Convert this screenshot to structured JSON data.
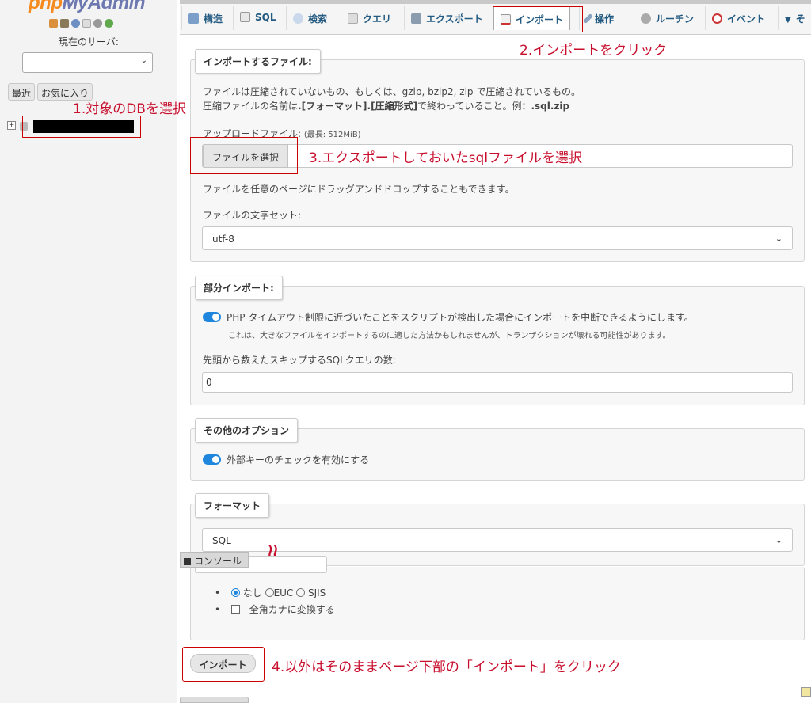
{
  "left": {
    "logo_a": "php",
    "logo_b": "MyAdmin",
    "server_label": "現在のサーバ:",
    "server_value": "",
    "recent_label": "最近",
    "favorites_label": "お気に入り",
    "tree_expander": "+"
  },
  "tabs": [
    {
      "label": "構造",
      "icon": "structure-icon"
    },
    {
      "label": "SQL",
      "icon": "sql-icon"
    },
    {
      "label": "検索",
      "icon": "search-icon"
    },
    {
      "label": "クエリ",
      "icon": "query-icon"
    },
    {
      "label": "エクスポート",
      "icon": "export-icon"
    },
    {
      "label": "インポート",
      "icon": "import-icon"
    },
    {
      "label": "操作",
      "icon": "wrench-icon"
    },
    {
      "label": "ルーチン",
      "icon": "routines-icon"
    },
    {
      "label": "イベント",
      "icon": "clock-icon"
    },
    {
      "label": "そ",
      "icon": "chevron-down-icon"
    }
  ],
  "import_file": {
    "legend": "インポートするファイル:",
    "desc1": "ファイルは圧縮されていないもの、もしくは、gzip, bzip2, zip で圧縮されているもの。",
    "desc2_prefix": "圧縮ファイルの名前は",
    "desc2_bold1": ".[フォーマット].[圧縮形式]",
    "desc2_mid": "で終わっていること。例：",
    "desc2_bold2": ".sql.zip",
    "upload_label": "アップロードファイル:",
    "upload_max": "(最長: 512MiB)",
    "choose_file": "ファイルを選択",
    "drag_note": "ファイルを任意のページにドラッグアンドドロップすることもできます。",
    "charset_label": "ファイルの文字セット:",
    "charset_value": "utf-8"
  },
  "partial": {
    "legend": "部分インポート:",
    "toggle_label": "PHP タイムアウト制限に近づいたことをスクリプトが検出した場合にインポートを中断できるようにします。",
    "toggle_note": "これは、大きなファイルをインポートするのに適した方法かもしれませんが、トランザクションが壊れる可能性があります。",
    "skip_label": "先頭から数えたスキップするSQLクエリの数:",
    "skip_value": "0"
  },
  "other": {
    "legend": "その他のオプション",
    "fk_label": "外部キーのチェックを有効にする"
  },
  "format": {
    "legend": "フォーマット",
    "value": "SQL",
    "opt_none": "なし",
    "opt_euc": "EUC",
    "opt_sjis": "SJIS",
    "kana_label": "全角カナに変換する"
  },
  "console_label": "コンソール",
  "import_button": "インポート",
  "annotations": {
    "a1": "1.対象のDBを選択",
    "a2": "2.インポートをクリック",
    "a3": "3.エクスポートしておいたsqlファイルを選択",
    "a4": "4.以外はそのままページ下部の「インポート」をクリック",
    "cut_mark": "≀≀"
  },
  "colors": {
    "accent": "#1f86de",
    "annotation": "#c8102e",
    "link": "#235a81"
  }
}
